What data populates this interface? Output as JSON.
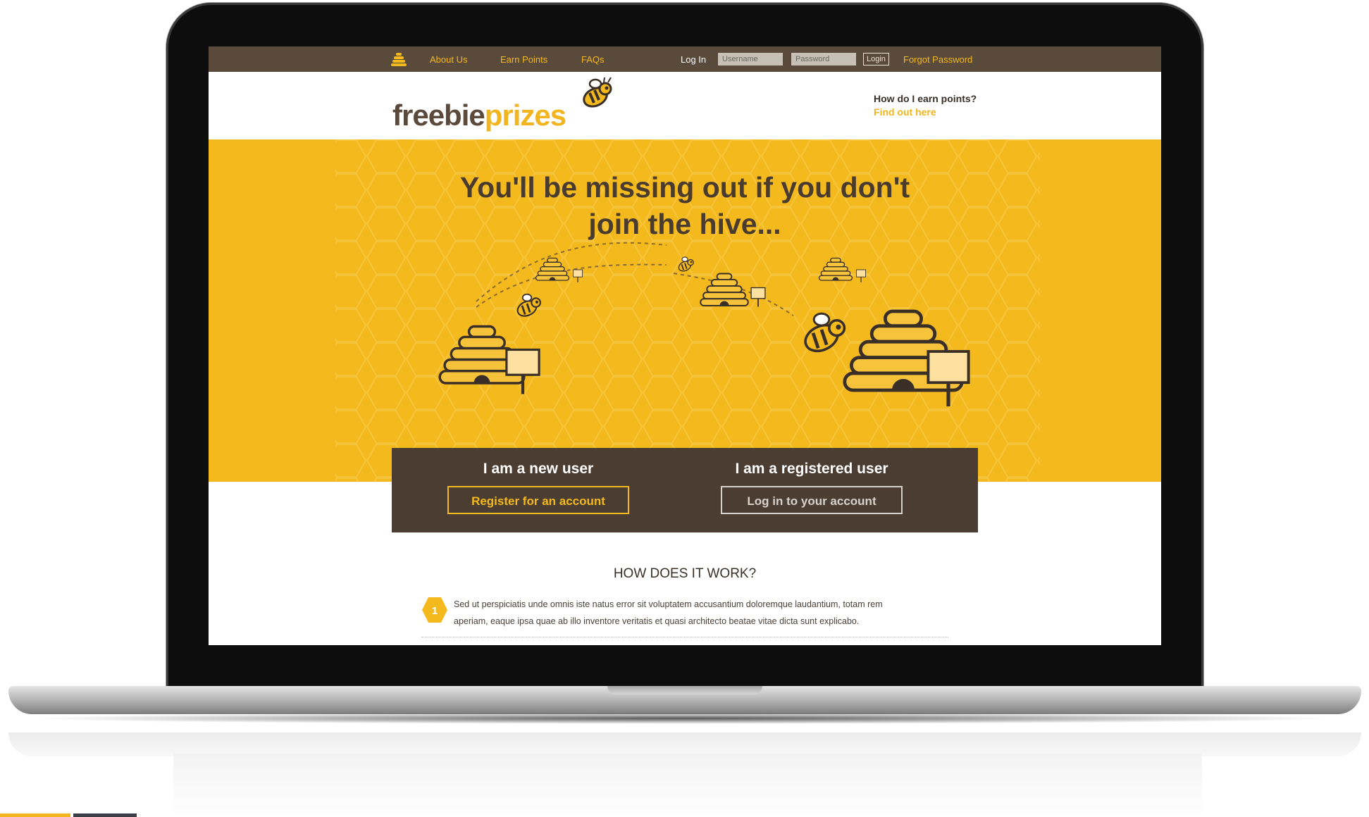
{
  "nav": {
    "links": [
      "About Us",
      "Earn Points",
      "FAQs"
    ],
    "login_label": "Log In",
    "username_placeholder": "Username",
    "password_placeholder": "Password",
    "login_button": "Login",
    "forgot_password": "Forgot Password"
  },
  "brand": {
    "part1": "freebie",
    "part2": "prizes"
  },
  "help": {
    "question": "How do I earn points?",
    "link": "Find out here"
  },
  "hero": {
    "title_line1": "You'll be missing out if you don't",
    "title_line2": "join the hive..."
  },
  "cta": {
    "new_user_heading": "I am a new user",
    "register_button": "Register for an account",
    "registered_heading": "I am a registered user",
    "login_button": "Log in to your account"
  },
  "how": {
    "title": "HOW DOES IT WORK?",
    "steps": [
      {
        "number": "1",
        "text_line1": "Sed ut perspiciatis unde omnis iste natus error sit voluptatem accusantium doloremque laudantium, totam rem",
        "text_line2": "aperiam, eaque ipsa quae ab illo inventore veritatis et quasi architecto beatae vitae dicta sunt explicabo."
      }
    ]
  },
  "colors": {
    "accent": "#f4b91d",
    "brown": "#4b3d32",
    "nav_bg": "#5a4a3c"
  }
}
